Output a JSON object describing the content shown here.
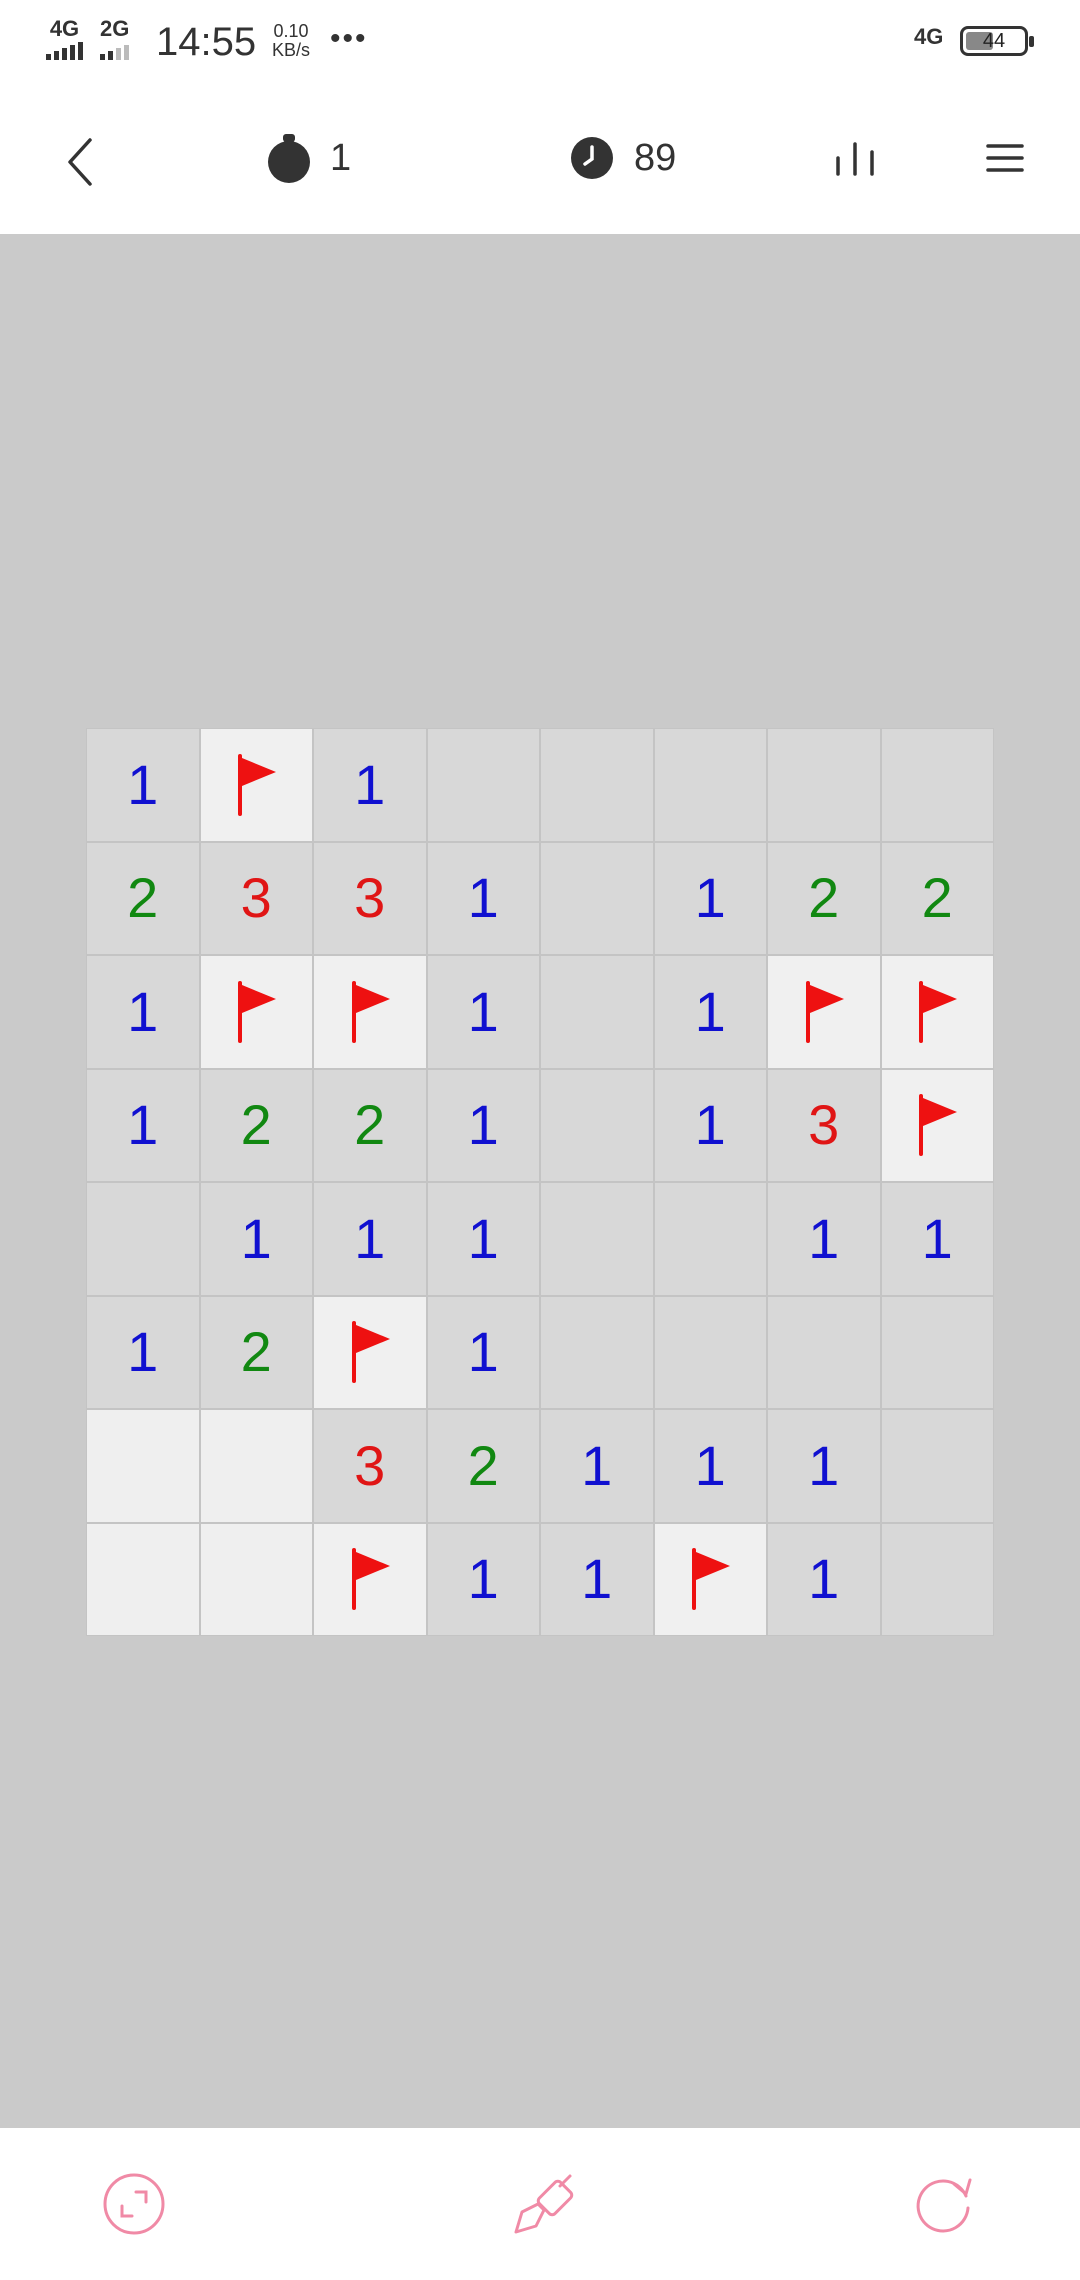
{
  "status_bar": {
    "network_1": "4G",
    "network_2": "2G",
    "time": "14:55",
    "speed_value": "0.10",
    "speed_unit": "KB/s",
    "more": "•••",
    "network_right": "4G",
    "battery": "44"
  },
  "toolbar": {
    "mines_remaining": "1",
    "timer": "89",
    "icons": [
      "back-icon",
      "bomb-icon",
      "clock-icon",
      "stats-icon",
      "menu-icon"
    ]
  },
  "board": {
    "rows": 8,
    "cols": 8,
    "legend": "F = flag, digit = number, '' = revealed empty, P = light empty",
    "cells": [
      [
        "1",
        "F",
        "1",
        "",
        "",
        "",
        "",
        ""
      ],
      [
        "2",
        "3",
        "3",
        "1",
        "",
        "1",
        "2",
        "2"
      ],
      [
        "1",
        "F",
        "F",
        "1",
        "",
        "1",
        "F",
        "F"
      ],
      [
        "1",
        "2",
        "2",
        "1",
        "",
        "1",
        "3",
        "F"
      ],
      [
        "",
        "1",
        "1",
        "1",
        "",
        "",
        "1",
        "1"
      ],
      [
        "1",
        "2",
        "F",
        "1",
        "",
        "",
        "",
        ""
      ],
      [
        "P",
        "P",
        "3",
        "2",
        "1",
        "1",
        "1",
        ""
      ],
      [
        "P",
        "P",
        "F",
        "1",
        "1",
        "F",
        "1",
        ""
      ]
    ],
    "number_colors": {
      "1": "#1010d0",
      "2": "#118811",
      "3": "#e01515"
    },
    "flag_color": "#ee1111"
  },
  "bottom_bar": {
    "icons": [
      "expand-icon",
      "shovel-icon",
      "restart-icon"
    ],
    "accent_color": "#f08aa6"
  }
}
